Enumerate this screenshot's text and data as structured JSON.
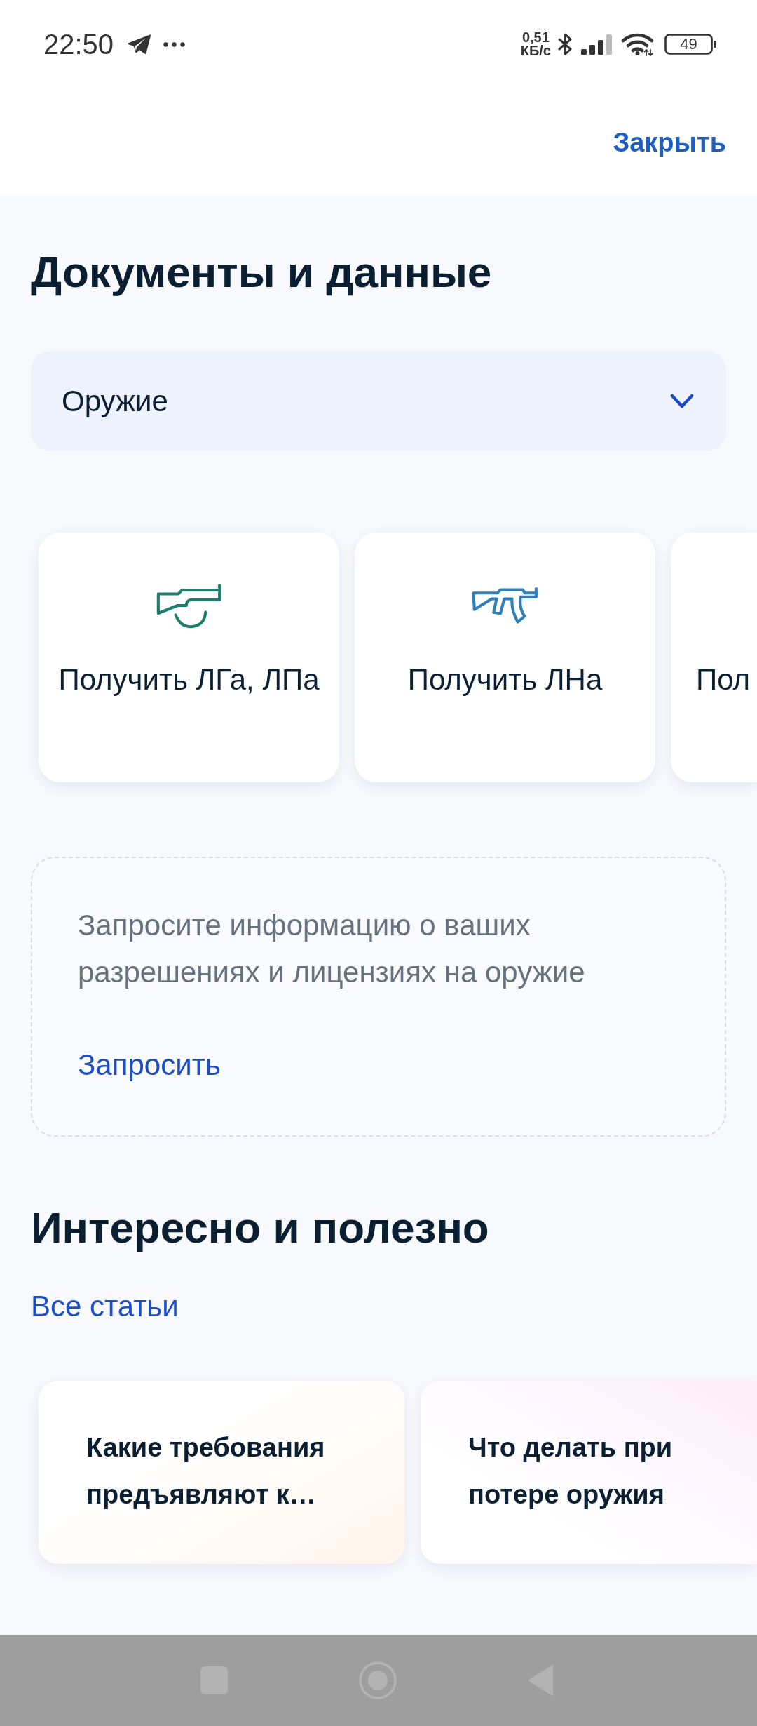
{
  "status_bar": {
    "time": "22:50",
    "network_speed": "0,51",
    "speed_unit": "КБ/с",
    "battery": "49"
  },
  "header": {
    "close_button": "Закрыть"
  },
  "documents": {
    "title": "Документы и данные",
    "category_select": {
      "value": "Оружие"
    },
    "services": [
      {
        "label": "Получить ЛГа, ЛПа"
      },
      {
        "label": "Получить ЛНа"
      },
      {
        "label": "Пол"
      }
    ],
    "info_card": {
      "text": "Запросите информацию о ваших разрешениях и лицензиях на оружие",
      "link": "Запросить"
    }
  },
  "articles": {
    "title": "Интересно и полезно",
    "all_link": "Все статьи",
    "items": [
      {
        "title": "Какие требования предъявляют к…"
      },
      {
        "title": "Что делать при потере оружия"
      }
    ]
  }
}
